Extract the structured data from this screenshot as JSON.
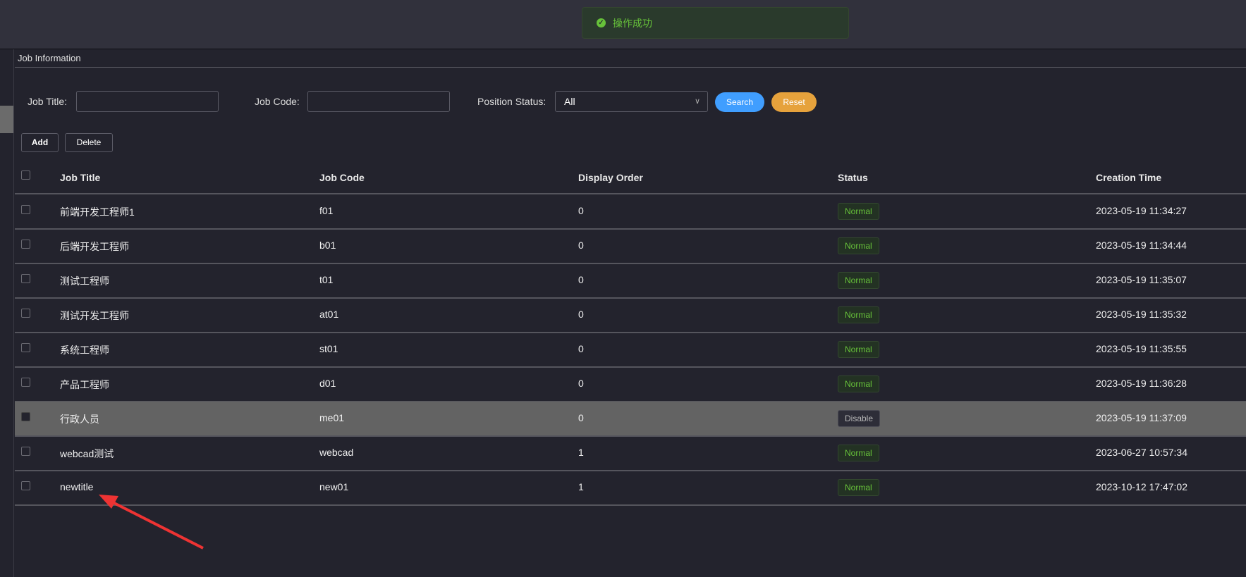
{
  "toast": {
    "icon": "check-circle-icon",
    "message": "操作成功",
    "color": "#67c23a"
  },
  "page": {
    "title": "Job Information"
  },
  "filters": {
    "job_title_label": "Job Title:",
    "job_title_value": "",
    "job_code_label": "Job Code:",
    "job_code_value": "",
    "status_label": "Position Status:",
    "status_value": "All",
    "search_label": "Search",
    "reset_label": "Reset",
    "search_color": "#409eff",
    "reset_color": "#e6a23c"
  },
  "toolbar": {
    "add_label": "Add",
    "delete_label": "Delete"
  },
  "table": {
    "headers": [
      "Job Title",
      "Job Code",
      "Display Order",
      "Status",
      "Creation Time"
    ],
    "rows": [
      {
        "title": "前端开发工程师1",
        "code": "f01",
        "order": "0",
        "status": "Normal",
        "time": "2023-05-19 11:34:27",
        "checked": false,
        "highlighted": false
      },
      {
        "title": "后端开发工程师",
        "code": "b01",
        "order": "0",
        "status": "Normal",
        "time": "2023-05-19 11:34:44",
        "checked": false,
        "highlighted": false
      },
      {
        "title": "测试工程师",
        "code": "t01",
        "order": "0",
        "status": "Normal",
        "time": "2023-05-19 11:35:07",
        "checked": false,
        "highlighted": false
      },
      {
        "title": "测试开发工程师",
        "code": "at01",
        "order": "0",
        "status": "Normal",
        "time": "2023-05-19 11:35:32",
        "checked": false,
        "highlighted": false
      },
      {
        "title": "系统工程师",
        "code": "st01",
        "order": "0",
        "status": "Normal",
        "time": "2023-05-19 11:35:55",
        "checked": false,
        "highlighted": false
      },
      {
        "title": "产品工程师",
        "code": "d01",
        "order": "0",
        "status": "Normal",
        "time": "2023-05-19 11:36:28",
        "checked": false,
        "highlighted": false
      },
      {
        "title": "行政人员",
        "code": "me01",
        "order": "0",
        "status": "Disable",
        "time": "2023-05-19 11:37:09",
        "checked": false,
        "highlighted": true
      },
      {
        "title": "webcad测试",
        "code": "webcad",
        "order": "1",
        "status": "Normal",
        "time": "2023-06-27 10:57:34",
        "checked": false,
        "highlighted": false
      },
      {
        "title": "newtitle",
        "code": "new01",
        "order": "1",
        "status": "Normal",
        "time": "2023-10-12 17:47:02",
        "checked": false,
        "highlighted": false
      }
    ]
  },
  "annotation": {
    "icon": "red-arrow-icon",
    "color": "#ee3333"
  }
}
